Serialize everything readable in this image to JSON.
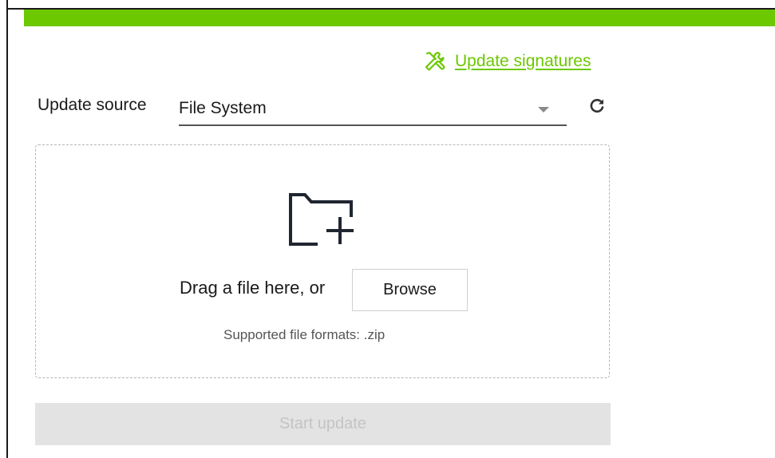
{
  "header": {
    "accent_color": "#6cc800"
  },
  "update_signatures": {
    "label": "Update signatures",
    "icon": "wrench-screwdriver-icon"
  },
  "source": {
    "label": "Update source",
    "selected": "File System",
    "refresh_icon": "refresh-icon"
  },
  "dropzone": {
    "icon": "folder-plus-icon",
    "drag_text": "Drag a file here, or",
    "browse_label": "Browse",
    "formats_text": "Supported file formats: .zip"
  },
  "actions": {
    "start_label": "Start update",
    "start_enabled": false
  }
}
